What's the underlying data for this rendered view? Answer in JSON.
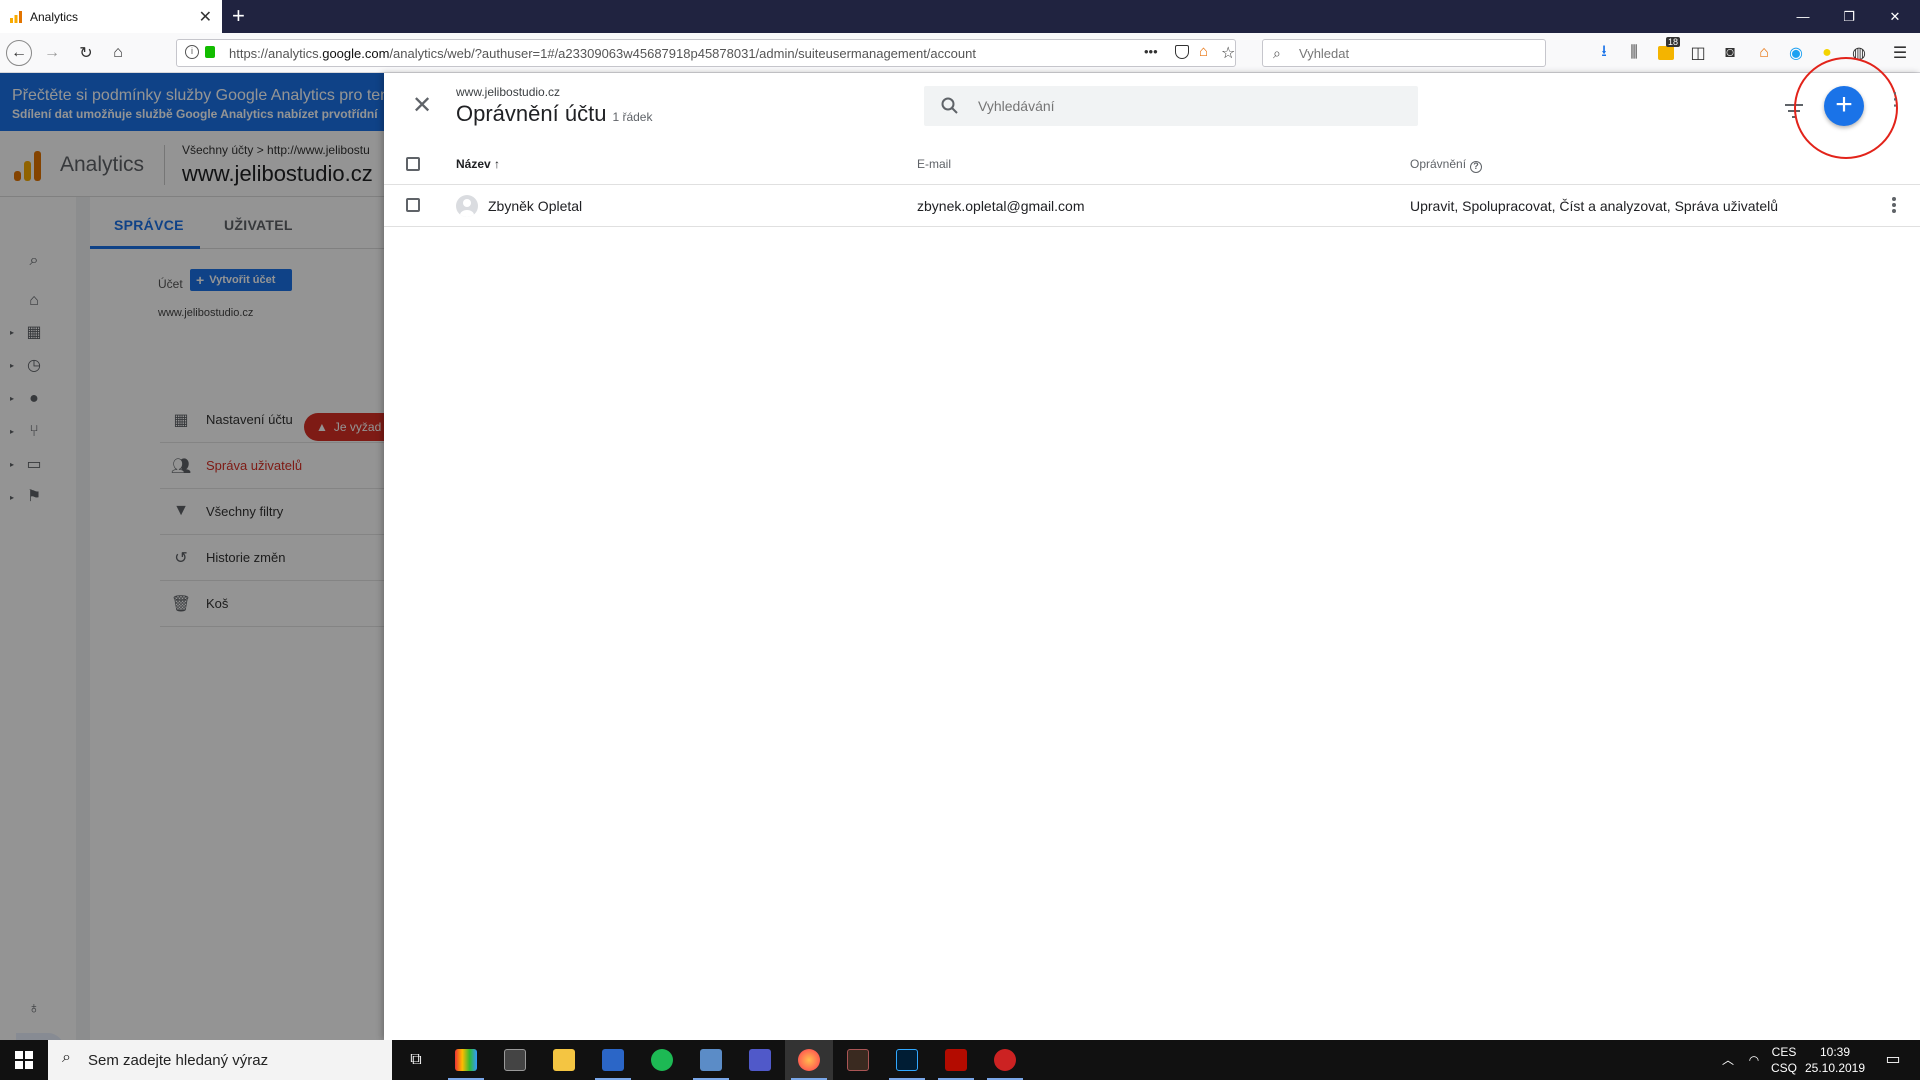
{
  "browser": {
    "tab_title": "Analytics",
    "url_prefix": "https://analytics.",
    "url_domain": "google.com",
    "url_rest": "/analytics/web/?authuser=1#/a23309063w45687918p45878031/admin/suiteusermanagement/account",
    "url_more": "•••",
    "search_placeholder": "Vyhledat",
    "badge_count": "18"
  },
  "ga": {
    "banner_line1": "Přečtěte si podmínky služby Google Analytics pro ten",
    "banner_line2": "Sdílení dat umožňuje službě Google Analytics nabízet prvotřídní",
    "app_title": "Analytics",
    "breadcrumb": "Všechny účty > http://www.jelibostu",
    "property": "www.jelibostudio.cz",
    "tabs": [
      "SPRÁVCE",
      "UŽIVATEL"
    ],
    "account_label": "Účet",
    "create_account": "Vytvořit účet",
    "account_name": "www.jelibostudio.cz",
    "menu": [
      {
        "label": "Nastavení účtu",
        "icon": "building-icon"
      },
      {
        "label": "Správa uživatelů",
        "icon": "people-icon"
      },
      {
        "label": "Všechny filtry",
        "icon": "filter-icon"
      },
      {
        "label": "Historie změn",
        "icon": "history-icon"
      },
      {
        "label": "Koš",
        "icon": "trash-icon"
      }
    ],
    "required_pill": "Je vyžad"
  },
  "panel": {
    "subtitle": "www.jelibostudio.cz",
    "title": "Oprávnění účtu",
    "row_count": "1 řádek",
    "search_placeholder": "Vyhledávání",
    "columns": {
      "name": "Název",
      "email": "E-mail",
      "permissions": "Oprávnění"
    },
    "sort_arrow": "↑",
    "rows": [
      {
        "name": "Zbyněk Opletal",
        "email": "zbynek.opletal@gmail.com",
        "permissions": "Upravit, Spolupracovat, Číst a analyzovat, Správa uživatelů"
      }
    ],
    "highlight_color": "#e2231a",
    "accent_color": "#1a73e8"
  },
  "taskbar": {
    "search_placeholder": "Sem zadejte hledaný výraz",
    "lang_top": "CES",
    "lang_bottom": "CSQ",
    "time": "10:39",
    "date": "25.10.2019"
  }
}
